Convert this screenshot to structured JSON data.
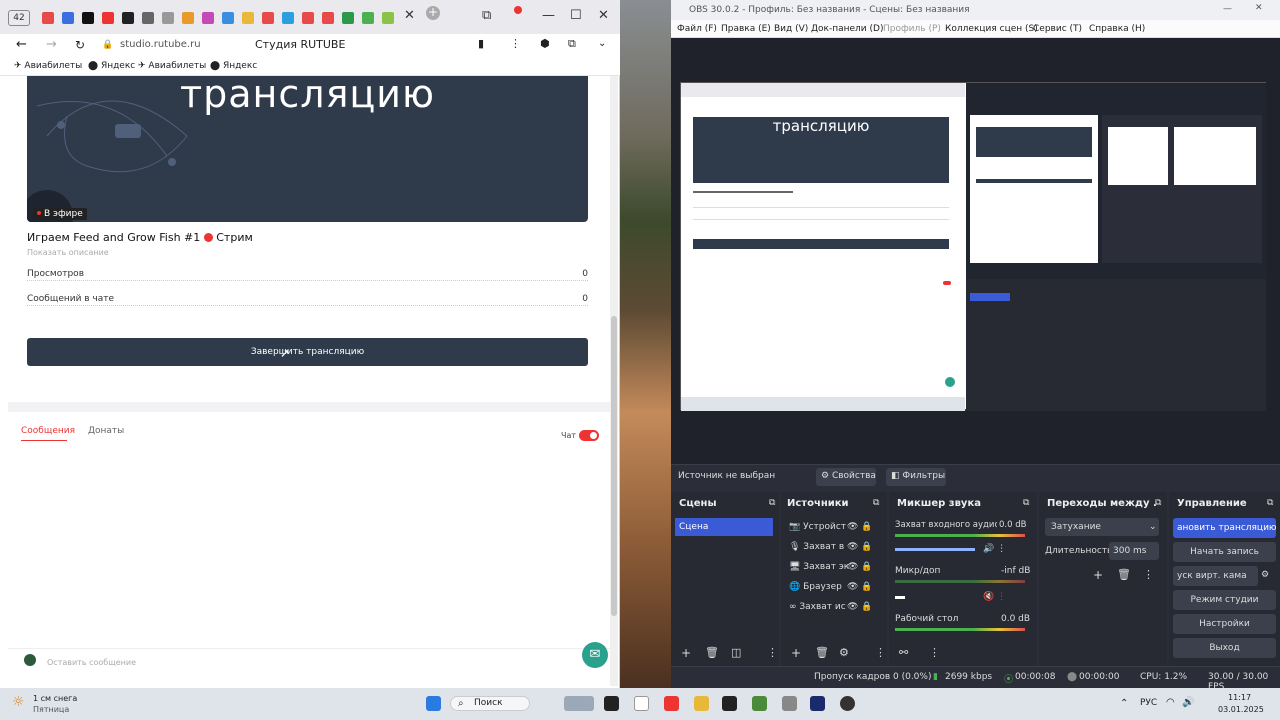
{
  "browser": {
    "tab_count": "42",
    "address": "studio.rutube.ru",
    "page_title": "Студия RUTUBE",
    "bookmarks": [
      "Авиабилеты",
      "Яндекс",
      "Авиабилеты",
      "Яндекс"
    ],
    "hero_title": "трансляцию",
    "on_air": "В эфире",
    "stream_title": "Играем Feed and Grow Fish #1",
    "stream_badge": "Стрим",
    "show_description": "Показать описание",
    "stats": [
      {
        "label": "Просмотров",
        "value": "0"
      },
      {
        "label": "Сообщений в чате",
        "value": "0"
      }
    ],
    "end_button": "Завершить трансляцию",
    "tabs": [
      "Сообщения",
      "Донаты"
    ],
    "chat_label": "Чат",
    "chat_enabled": true,
    "message_placeholder": "Оставить сообщение"
  },
  "obs": {
    "title": "OBS 30.0.2 - Профиль: Без названия - Сцены: Без названия",
    "menu": [
      "Файл (F)",
      "Правка (E)",
      "Вид (V)",
      "Док-панели (D)",
      "Профиль (P)",
      "Коллекция сцен (S)",
      "Сервис (T)",
      "Справка (H)"
    ],
    "preview_hero": "трансляцию",
    "no_source": "Источник не выбран",
    "properties": "Свойства",
    "filters": "Фильтры",
    "scenes": {
      "title": "Сцены",
      "items": [
        "Сцена"
      ]
    },
    "sources": {
      "title": "Источники",
      "items": [
        "Устройст",
        "Захват в",
        "Захват эк",
        "Браузер",
        "Захват ис"
      ]
    },
    "mixer": {
      "title": "Микшер звука",
      "tracks": [
        {
          "name": "Захват входного аудио",
          "level": "0.0 dB"
        },
        {
          "name": "Микр/доп",
          "level": "-inf dB"
        },
        {
          "name": "Рабочий стол",
          "level": "0.0 dB"
        }
      ]
    },
    "transitions": {
      "title": "Переходы между ...",
      "type": "Затухание",
      "duration_label": "Длительность",
      "duration": "300 ms"
    },
    "controls": {
      "title": "Управление",
      "buttons": [
        "ановить трансляцию",
        "Начать запись",
        "уск вирт. кама",
        "Режим студии",
        "Настройки",
        "Выход"
      ]
    },
    "status": {
      "dropped": "Пропуск кадров 0 (0.0%)",
      "bitrate": "2699 kbps",
      "stream_time": "00:00:08",
      "rec_time": "00:00:00",
      "cpu": "CPU: 1.2%",
      "fps": "30.00 / 30.00 FPS"
    }
  },
  "taskbar": {
    "weather_temp": "1 см снега",
    "weather_sub": "Пятница",
    "search": "Поиск",
    "lang": "РУС",
    "time": "11:17",
    "date": "03.01.2025"
  }
}
